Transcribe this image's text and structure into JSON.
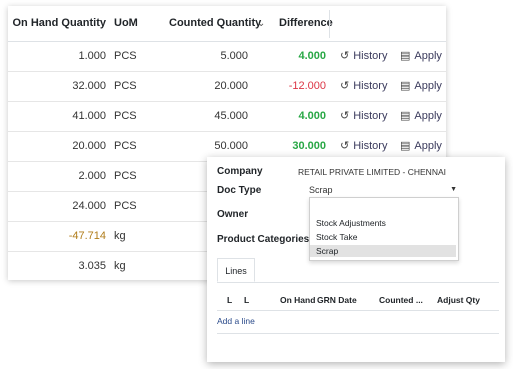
{
  "table": {
    "headers": {
      "on_hand": "On Hand Quantity",
      "uom": "UoM",
      "counted": "Counted Quantity",
      "sort_icon": "⌄",
      "difference": "Difference"
    },
    "rows": [
      {
        "on_hand": "1.000",
        "uom": "PCS",
        "counted": "5.000",
        "difference": "4.000",
        "history": "History",
        "apply": "Apply"
      },
      {
        "on_hand": "32.000",
        "uom": "PCS",
        "counted": "20.000",
        "difference": "-12.000",
        "history": "History",
        "apply": "Apply"
      },
      {
        "on_hand": "41.000",
        "uom": "PCS",
        "counted": "45.000",
        "difference": "4.000",
        "history": "History",
        "apply": "Apply"
      },
      {
        "on_hand": "20.000",
        "uom": "PCS",
        "counted": "50.000",
        "difference": "30.000",
        "history": "History",
        "apply": "Apply"
      },
      {
        "on_hand": "2.000",
        "uom": "PCS"
      },
      {
        "on_hand": "24.000",
        "uom": "PCS"
      },
      {
        "on_hand": "-47.714",
        "uom": "kg"
      },
      {
        "on_hand": "3.035",
        "uom": "kg"
      }
    ],
    "icons": {
      "history": "history-icon",
      "apply": "save-icon"
    }
  },
  "colors": {
    "positive": "#28a745",
    "negative": "#dc3545",
    "negative_onhand": "#b07c1a"
  },
  "dialog": {
    "company_label": "Company",
    "company_value": "RETAIL PRIVATE LIMITED - CHENNAI",
    "doc_type_label": "Doc Type",
    "doc_type_value": "Scrap",
    "owner_label": "Owner",
    "product_categories_label": "Product Categories",
    "doc_type_options": [
      "",
      "Stock Adjustments",
      "Stock Take",
      "Scrap"
    ],
    "tab_lines": "Lines",
    "lines_headers": [
      "L",
      "L",
      "On Hand",
      "GRN Date",
      "Counted ...",
      "Adjust Qty"
    ],
    "add_line": "Add a line"
  }
}
